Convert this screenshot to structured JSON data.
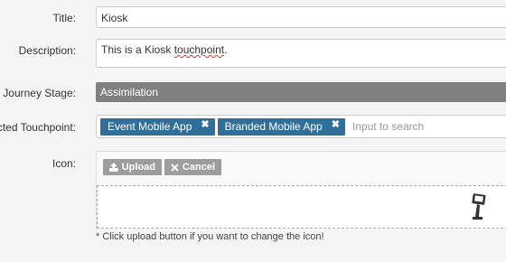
{
  "form": {
    "title": {
      "label": "Title:",
      "value": "Kiosk"
    },
    "description": {
      "label": "Description:",
      "value_plain": "This is a Kiosk ",
      "value_misspelled": "touchpoint",
      "value_end": "."
    },
    "stage": {
      "label": "ner Journey Stage:",
      "value": "Assimilation"
    },
    "touchpoints": {
      "label": "nected Touchpoint:",
      "tags": [
        "Event Mobile App",
        "Branded Mobile App"
      ],
      "remove_glyph": "✖",
      "placeholder": "Input to search"
    },
    "icon": {
      "label": "Icon:",
      "upload_label": "Upload",
      "cancel_label": "Cancel",
      "upload_icon": "upload-icon",
      "cancel_icon": "close-icon",
      "preview_icon": "kiosk-icon",
      "hint": "* Click upload button if you want to change the icon!"
    }
  },
  "colors": {
    "tag": "#2f6f99",
    "stage_bar": "#808080",
    "button": "#9d9d9d"
  }
}
